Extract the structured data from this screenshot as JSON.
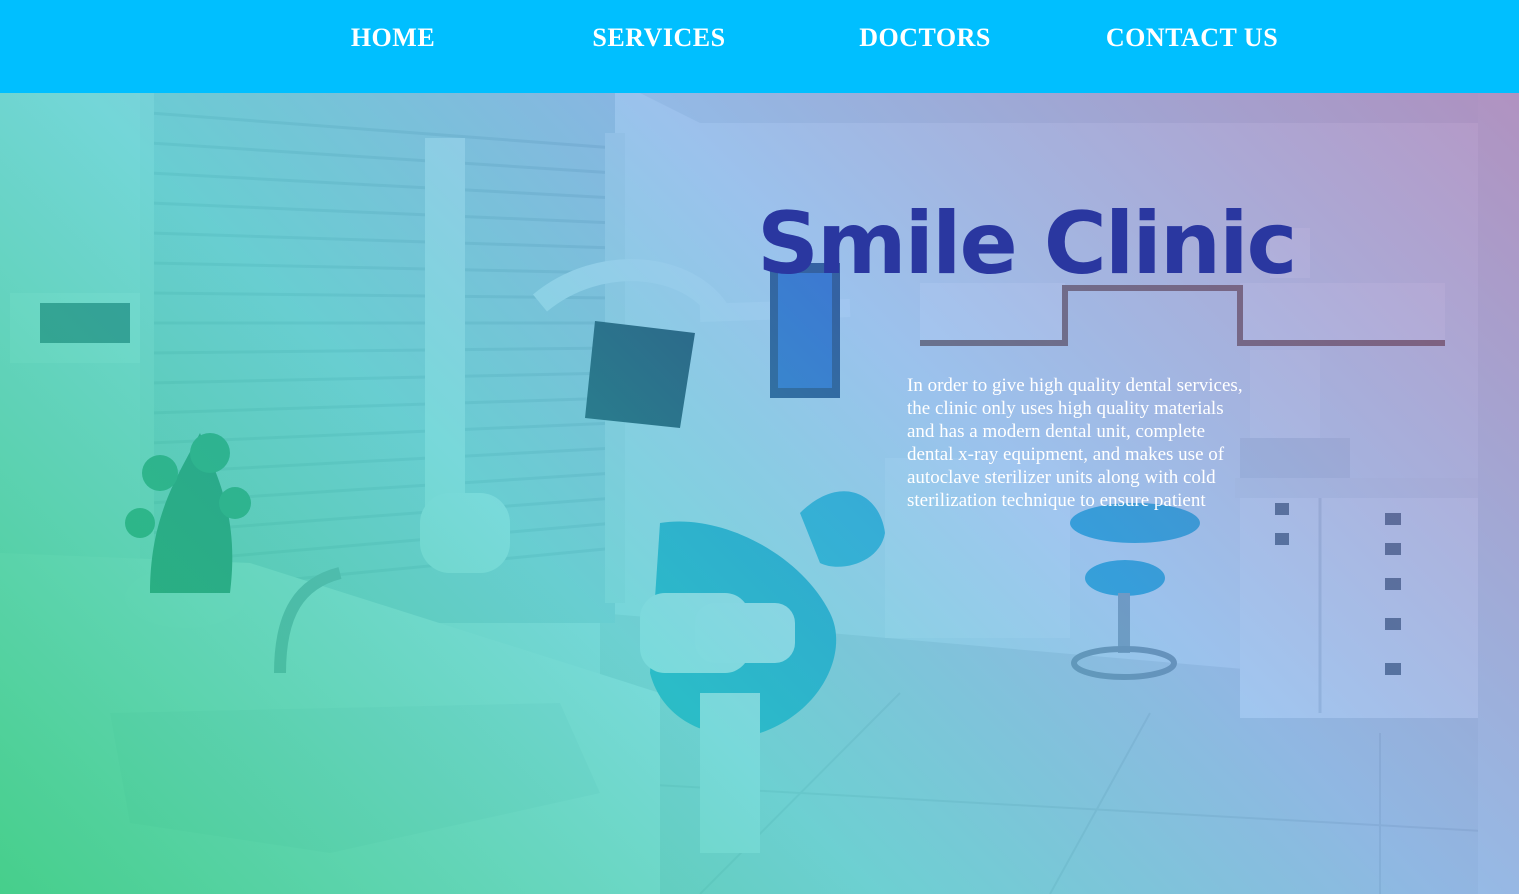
{
  "nav": {
    "home": "HOME",
    "services": "SERVICES",
    "doctors": "DOCTORS",
    "contact": "CONTACT US"
  },
  "hero": {
    "title": "Smile Clinic",
    "description": "In order to give high quality dental services, the clinic only uses high quality materials and has a modern dental unit, complete dental x-ray equipment, and makes use of autoclave sterilizer units along with cold sterilization technique to ensure patient"
  },
  "colors": {
    "navbar": "#00bfff",
    "title": "#2a37a0",
    "text": "#ffffff"
  }
}
